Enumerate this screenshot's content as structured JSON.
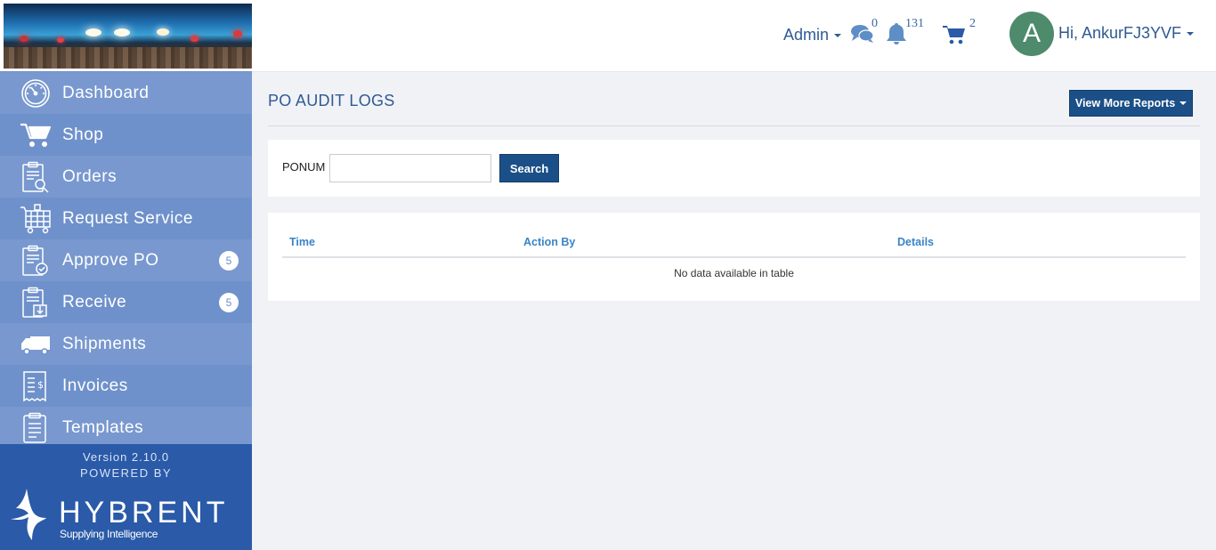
{
  "sidebar": {
    "items": [
      {
        "label": "Dashboard",
        "icon": "dashboard-icon"
      },
      {
        "label": "Shop",
        "icon": "cart-icon"
      },
      {
        "label": "Orders",
        "icon": "clipboard-search-icon"
      },
      {
        "label": "Request Service",
        "icon": "service-cart-icon"
      },
      {
        "label": "Approve PO",
        "icon": "clipboard-check-icon",
        "badge": "5"
      },
      {
        "label": "Receive",
        "icon": "clipboard-download-icon",
        "badge": "5"
      },
      {
        "label": "Shipments",
        "icon": "truck-icon"
      },
      {
        "label": "Invoices",
        "icon": "invoice-icon"
      },
      {
        "label": "Templates",
        "icon": "clipboard-list-icon"
      }
    ],
    "version": "Version 2.10.0",
    "powered_by": "POWERED BY",
    "brand_name": "HYBRENT",
    "brand_tagline": "Supplying Intelligence"
  },
  "topbar": {
    "role": "Admin",
    "messages_count": "0",
    "notifications_count": "131",
    "cart_count": "2",
    "avatar_initial": "A",
    "greeting": "Hi, AnkurFJ3YVF"
  },
  "page": {
    "title": "PO AUDIT LOGS",
    "more_reports_label": "View More Reports"
  },
  "search": {
    "label": "PONUM",
    "value": "",
    "placeholder": "",
    "button_label": "Search"
  },
  "table": {
    "columns": [
      "Time",
      "Action By",
      "Details"
    ],
    "empty_message": "No data available in table"
  },
  "colors": {
    "sidebar": "#6d8fca",
    "sidebar_footer": "#2a5aa8",
    "primary_button": "#1b4f87",
    "title": "#2f5a93",
    "table_header": "#3a84c6"
  }
}
